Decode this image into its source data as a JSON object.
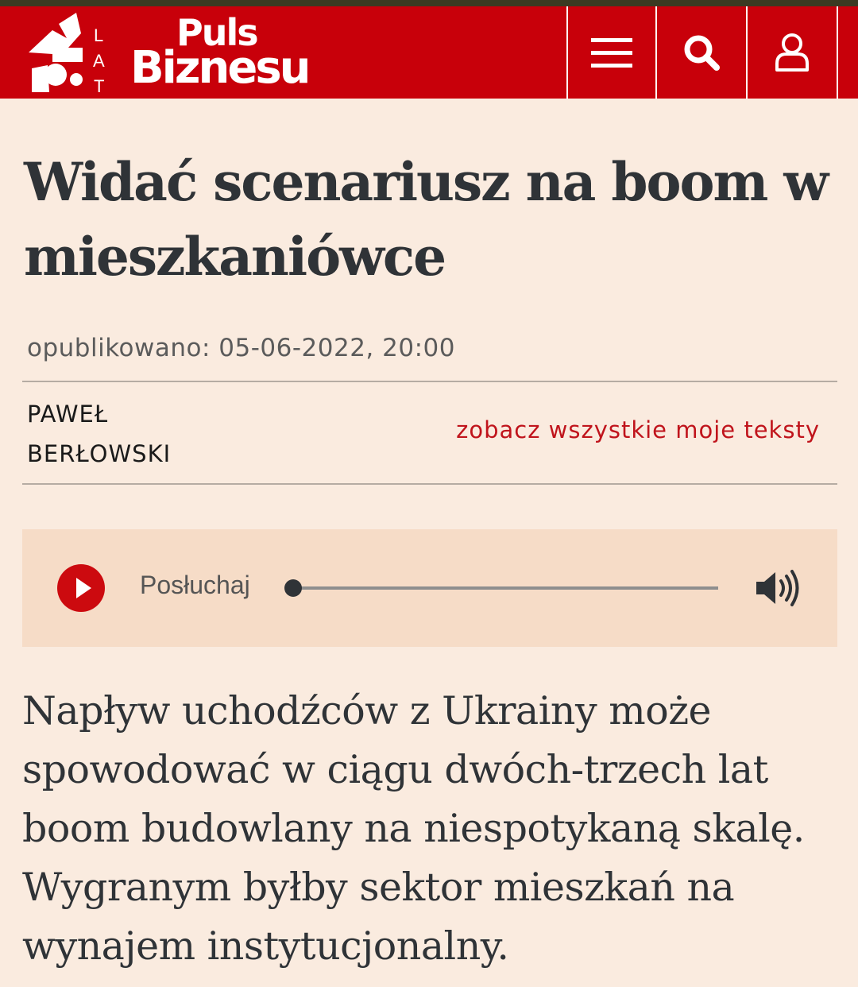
{
  "header": {
    "logo": {
      "anniversary_number": "25",
      "anniversary_letters": [
        "L",
        "A",
        "T"
      ],
      "name_line1": "Puls",
      "name_line2": "Biznesu"
    },
    "buttons": [
      "menu-icon",
      "search-icon",
      "user-icon"
    ],
    "colors": {
      "brand_red": "#c8000a",
      "top_strip": "#3b3a22"
    }
  },
  "article": {
    "title": "Widać scenariusz na boom w mieszkaniówce",
    "published": "opublikowano: 05-06-2022, 20:00",
    "author": {
      "first": "PAWEŁ",
      "last": "BERŁOWSKI"
    },
    "all_texts_link": "zobacz wszystkie moje teksty",
    "lead": "Napływ uchodźców z Ukrainy może spowodować w ciągu dwóch-trzech lat boom budowlany na niespotykaną skalę. Wygranym byłby sektor mieszkań na wynajem instytucjonalny."
  },
  "player": {
    "label": "Posłuchaj",
    "progress": 0,
    "icons": [
      "play-icon",
      "volume-icon"
    ]
  },
  "colors": {
    "background": "#faebdf",
    "player_bg": "#f6dcc7",
    "link_red": "#c0141c",
    "text": "#2f3337"
  }
}
